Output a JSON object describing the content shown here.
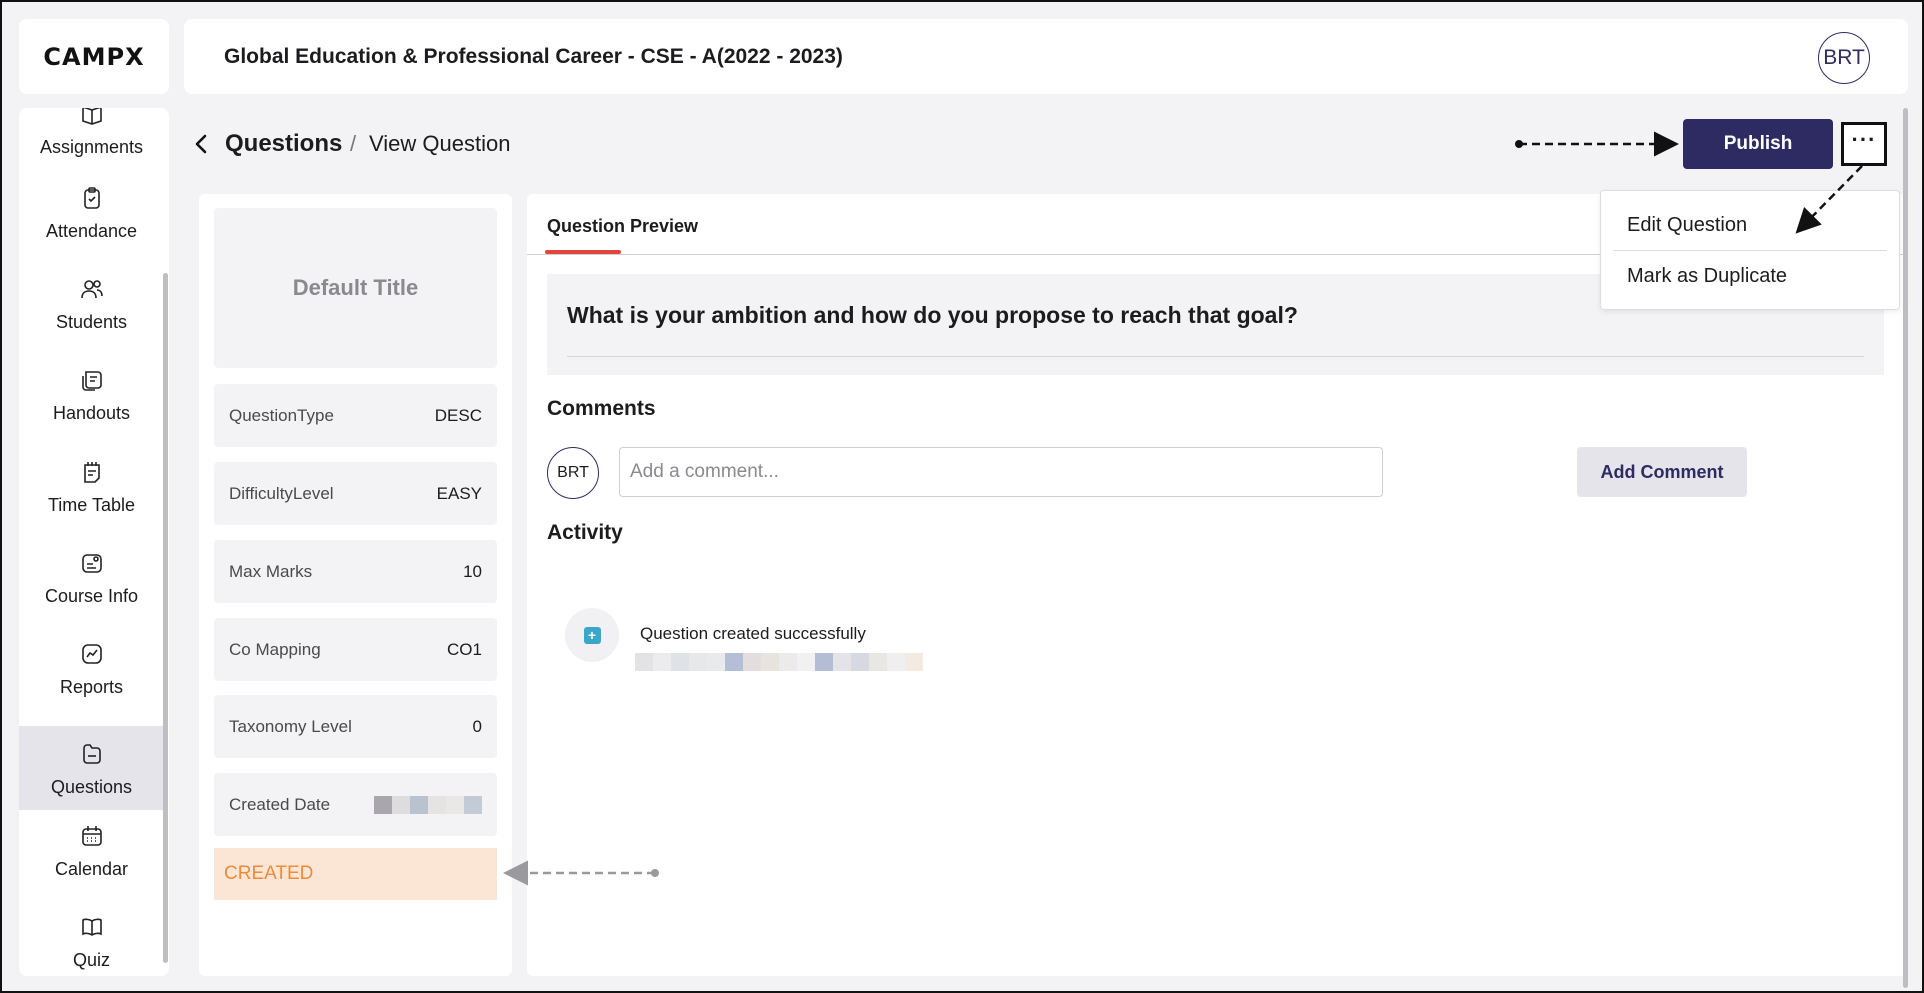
{
  "logo": "CAMPX",
  "header": {
    "title": "Global Education & Professional Career - CSE - A(2022 - 2023)",
    "avatar": "BRT"
  },
  "sidebar": {
    "items": [
      {
        "label": "Assignments",
        "icon": "assignments-icon"
      },
      {
        "label": "Attendance",
        "icon": "attendance-icon"
      },
      {
        "label": "Students",
        "icon": "students-icon"
      },
      {
        "label": "Handouts",
        "icon": "handouts-icon"
      },
      {
        "label": "Time Table",
        "icon": "time-table-icon"
      },
      {
        "label": "Course Info",
        "icon": "course-info-icon"
      },
      {
        "label": "Reports",
        "icon": "reports-icon"
      },
      {
        "label": "Questions",
        "icon": "questions-icon",
        "active": true
      },
      {
        "label": "Calendar",
        "icon": "calendar-icon"
      },
      {
        "label": "Quiz",
        "icon": "quiz-icon"
      }
    ]
  },
  "breadcrumb": {
    "parent": "Questions",
    "separator": "/",
    "current": "View Question"
  },
  "actions": {
    "publish": "Publish",
    "more": "···"
  },
  "menu": {
    "items": [
      "Edit Question",
      "Mark as Duplicate"
    ]
  },
  "details": {
    "title": "Default Title",
    "rows": [
      {
        "key": "QuestionType",
        "value": "DESC"
      },
      {
        "key": "DifficultyLevel",
        "value": "EASY"
      },
      {
        "key": "Max Marks",
        "value": "10"
      },
      {
        "key": "Co Mapping",
        "value": "CO1"
      },
      {
        "key": "Taxonomy Level",
        "value": "0"
      },
      {
        "key": "Created Date",
        "value": ""
      }
    ],
    "status": "CREATED"
  },
  "main": {
    "tab": "Question Preview",
    "question": "What is your ambition and how do you propose to reach that goal?",
    "comments_heading": "Comments",
    "comment_avatar": "BRT",
    "comment_placeholder": "Add a comment...",
    "add_comment": "Add Comment",
    "activity_heading": "Activity",
    "activity_item": "Question created successfully"
  },
  "colors": {
    "primary": "#2d2b62",
    "accent_red": "#e2453c",
    "status_bg": "#fbe6d6",
    "status_text": "#ef8a3a",
    "activity_icon": "#3aa6c8"
  }
}
